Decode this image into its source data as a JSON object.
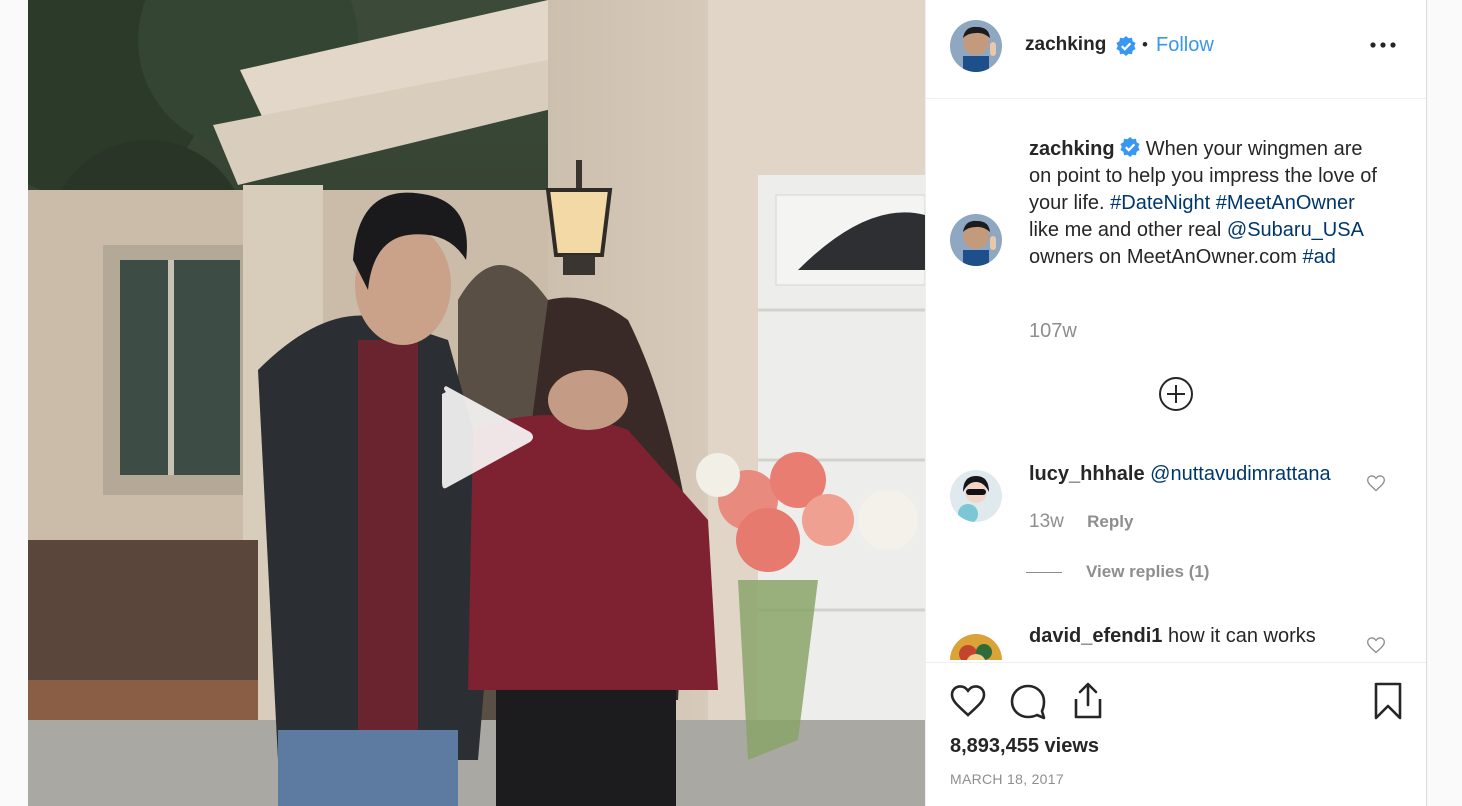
{
  "post": {
    "author": "zachking",
    "follow_label": "Follow",
    "separator": "•",
    "caption_author": "zachking",
    "caption_parts": {
      "t1": "When your wingmen are on point to help you impress the love of your life.",
      "h1": "#DateNight",
      "h2": "#MeetAnOwner",
      "t2": "like me and other real",
      "m1": "@Subaru_USA",
      "t3": "owners on MeetAnOwner.com",
      "h3": "#ad"
    },
    "caption_time": "107w",
    "views": "8,893,455 views",
    "date": "MARCH 18, 2017"
  },
  "comments": [
    {
      "user": "lucy_hhhale",
      "text": "@nuttavudimrattana",
      "time": "13w",
      "reply_label": "Reply",
      "view_replies": "View replies (1)"
    },
    {
      "user": "david_efendi1",
      "text": "how it can works"
    }
  ],
  "icons": {
    "play": "play-icon",
    "more": "more-options-icon",
    "verified": "verified-badge-icon",
    "load_more": "plus-circle-icon",
    "like": "heart-icon",
    "comment": "comment-bubble-icon",
    "share": "share-icon",
    "save": "bookmark-icon"
  },
  "colors": {
    "link": "#00376b",
    "follow": "#3897f0",
    "verified": "#3897f0",
    "muted": "#8e8e8e"
  }
}
